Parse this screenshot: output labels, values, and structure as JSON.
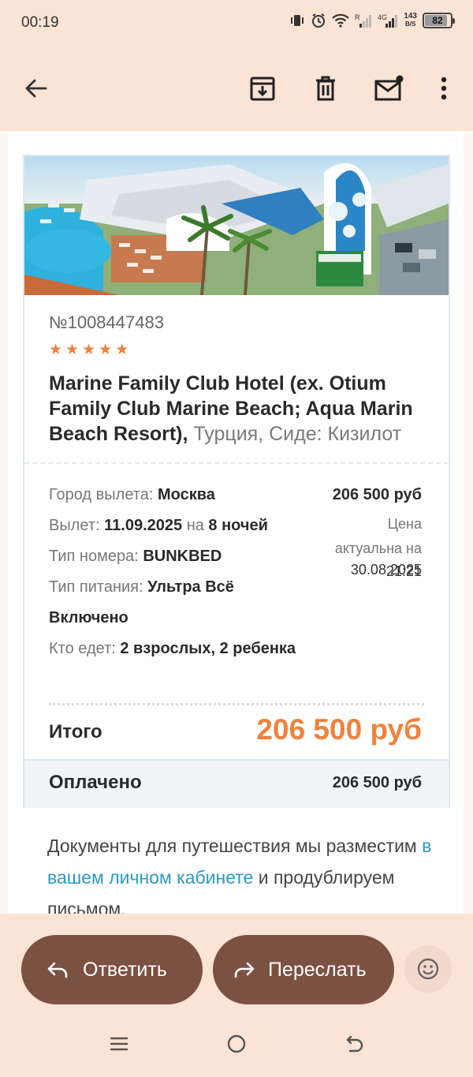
{
  "status_bar": {
    "time": "00:19",
    "net_speed_value": "143",
    "net_speed_unit": "B/S",
    "battery": "82",
    "icons": [
      "vibrate-icon",
      "alarm-icon",
      "wifi-icon",
      "signal-r-icon",
      "signal-4g-icon"
    ]
  },
  "toolbar": {
    "icons": [
      "back-arrow-icon",
      "archive-icon",
      "delete-icon",
      "mark-unread-icon",
      "more-vert-icon"
    ]
  },
  "card": {
    "order_number": "№1008447483",
    "stars": 5,
    "hotel_name": "Marine Family Club Hotel (ex. Otium Family Club Marine Beach; Aqua Marin Beach Resort),",
    "hotel_location": "Турция, Сиде: Кизилот",
    "departure_city_label": "Город вылета:",
    "departure_city": "Москва",
    "departure_label": "Вылет:",
    "departure_date": "11.09.2025",
    "nights_prefix": "на",
    "nights": "8 ночей",
    "room_type_label": "Тип номера:",
    "room_type": "BUNKBED",
    "meal_label": "Тип питания:",
    "meal": "Ультра Всё Включено",
    "travelers_label": "Кто едет:",
    "travelers": "2 взрослых, 2 ребенка",
    "price": "206 500 руб",
    "price_note_1": "Цена",
    "price_note_2": "актуальна на",
    "price_date": "30.08.2025",
    "price_time": "21:21",
    "total_label": "Итого",
    "total_value": "206 500 руб",
    "paid_label": "Оплачено",
    "paid_value": "206 500 руб"
  },
  "docs": {
    "text_before": "Документы для путешествия мы разместим",
    "link": "в вашем личном кабинете",
    "text_after": "и продублируем письмом."
  },
  "actions": {
    "reply_label": "Ответить",
    "forward_label": "Переслать"
  },
  "colors": {
    "background": "#fbe3d5",
    "accent_orange": "#f0823c",
    "pill_brown": "#7b5142",
    "link_blue": "#2a9bc7"
  }
}
